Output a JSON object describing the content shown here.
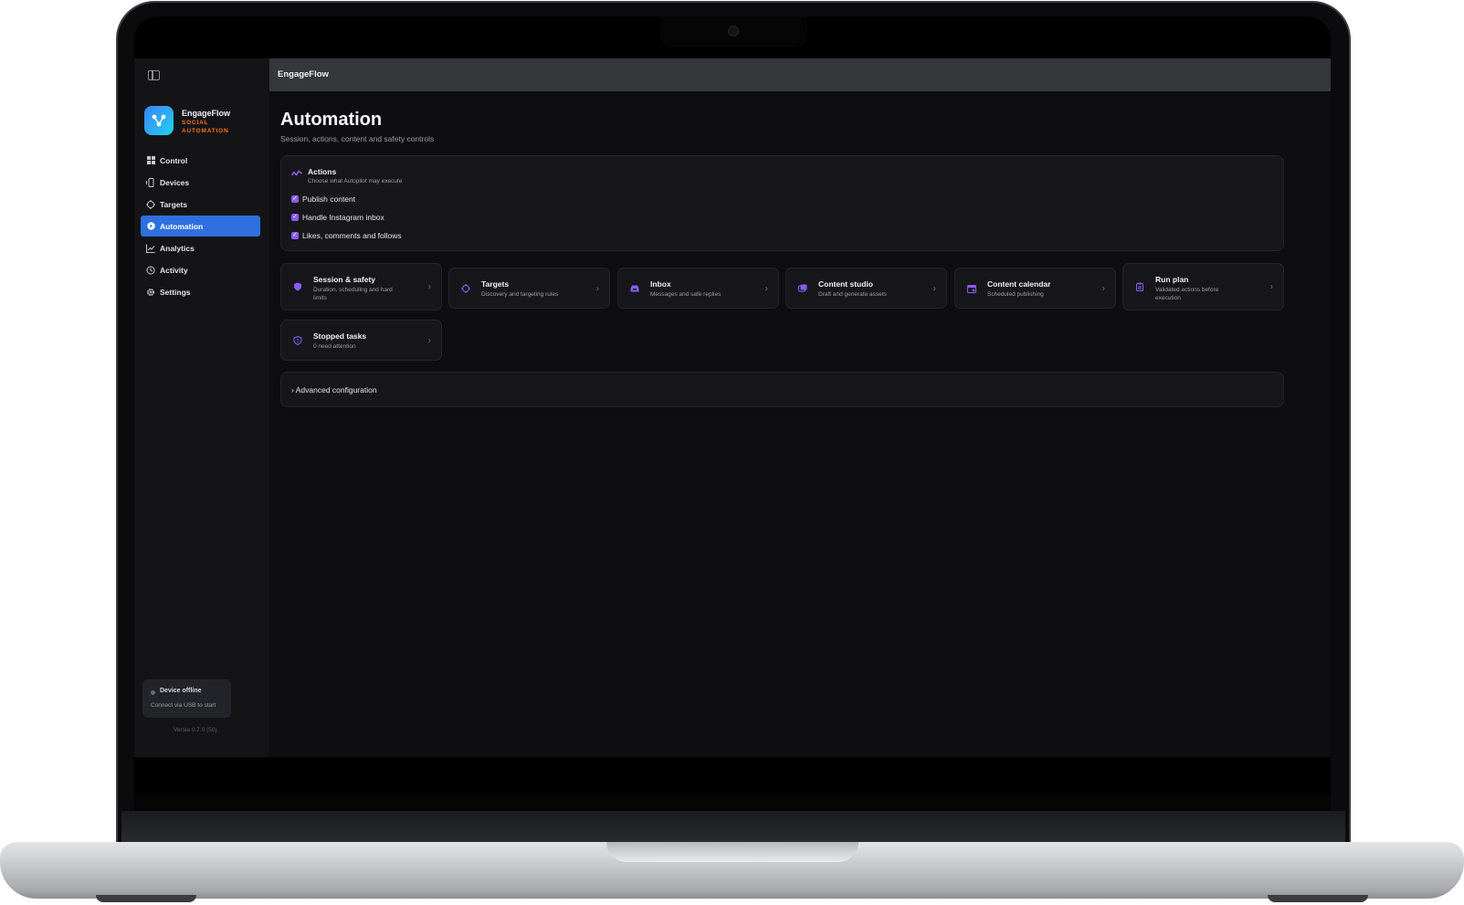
{
  "window": {
    "title": "EngageFlow"
  },
  "sidebar": {
    "brand_name": "EngageFlow",
    "brand_tagline": "SOCIAL AUTOMATION",
    "items": [
      {
        "label": "Control",
        "icon": "grid-icon"
      },
      {
        "label": "Devices",
        "icon": "phone-icon"
      },
      {
        "label": "Targets",
        "icon": "crosshair-icon"
      },
      {
        "label": "Automation",
        "icon": "automation-icon",
        "active": true
      },
      {
        "label": "Analytics",
        "icon": "chart-icon"
      },
      {
        "label": "Activity",
        "icon": "history-icon"
      },
      {
        "label": "Settings",
        "icon": "gear-icon"
      }
    ],
    "status": {
      "title": "Device offline",
      "subtitle": "Connect via USB to start"
    },
    "version": "Versie 0.7.0 (50)"
  },
  "page": {
    "title": "Automation",
    "subtitle": "Session, actions, content and safety controls"
  },
  "actions": {
    "title": "Actions",
    "subtitle": "Choose what Autopilot may execute",
    "options": [
      {
        "label": "Publish content",
        "checked": true
      },
      {
        "label": "Handle Instagram inbox",
        "checked": true
      },
      {
        "label": "Likes, comments and follows",
        "checked": true
      }
    ]
  },
  "cards": [
    {
      "title": "Session & safety",
      "subtitle": "Duration, scheduling and hard limits",
      "icon": "shield-icon"
    },
    {
      "title": "Targets",
      "subtitle": "Discovery and targeting rules",
      "icon": "crosshair-icon"
    },
    {
      "title": "Inbox",
      "subtitle": "Messages and safe replies",
      "icon": "inbox-icon"
    },
    {
      "title": "Content studio",
      "subtitle": "Draft and generate assets",
      "icon": "images-icon"
    },
    {
      "title": "Content calendar",
      "subtitle": "Scheduled publishing",
      "icon": "calendar-icon"
    },
    {
      "title": "Run plan",
      "subtitle": "Validated actions before execution",
      "icon": "clipboard-icon"
    },
    {
      "title": "Stopped tasks",
      "subtitle": "0 need attention",
      "icon": "shield-alert-icon"
    }
  ],
  "advanced": {
    "label": "Advanced configuration"
  },
  "colors": {
    "accent": "#2f6fe0",
    "icon_purple": "#8b5cf6",
    "brand_orange": "#f97316",
    "background": "#0e0e11"
  }
}
